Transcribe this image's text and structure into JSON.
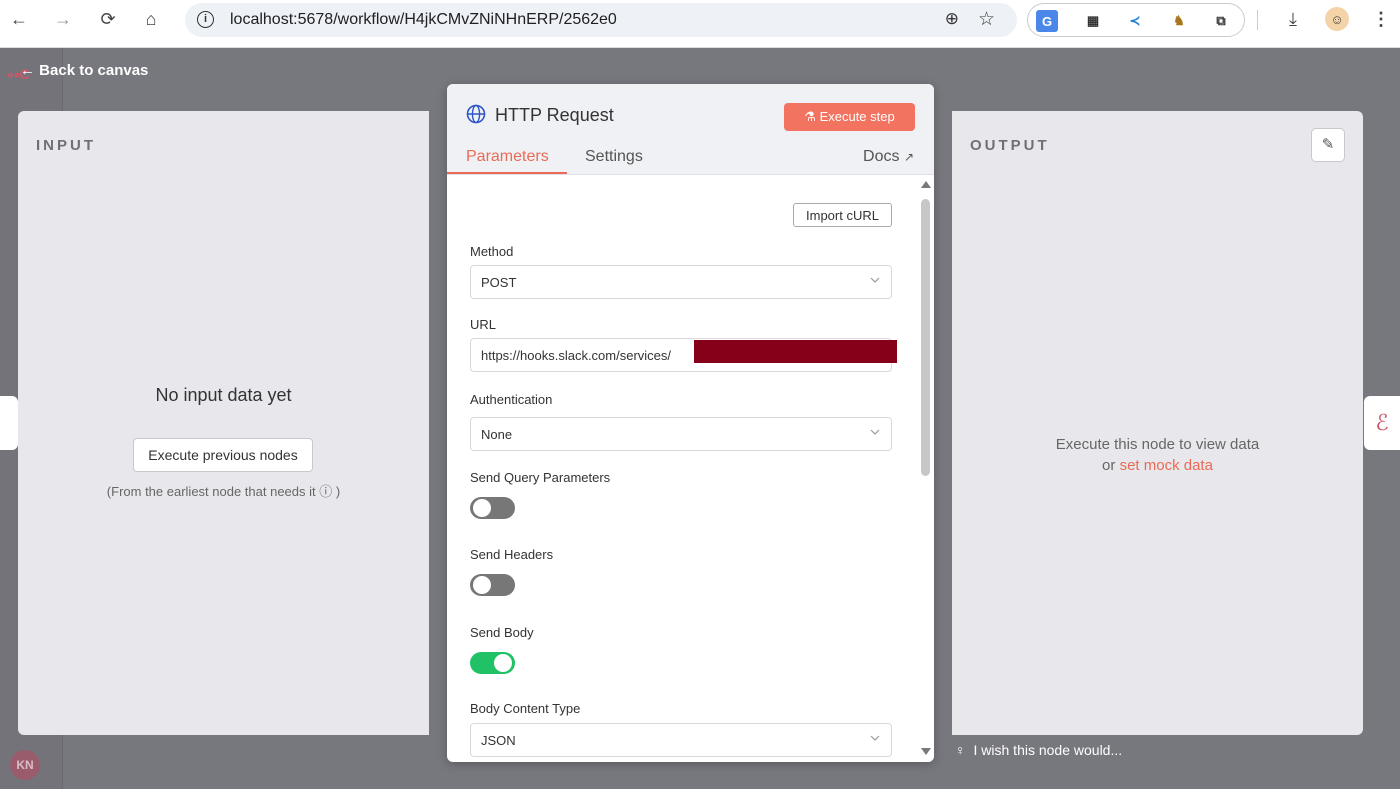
{
  "browser": {
    "url": "localhost:5678/workflow/H4jkCMvZNiNHnERP/2562e0"
  },
  "app": {
    "back_label": "Back to canvas",
    "avatar_initials": "KN"
  },
  "input_panel": {
    "title": "INPUT",
    "empty_message": "No input data yet",
    "execute_previous_label": "Execute previous nodes",
    "hint": "(From the earliest node that needs it ⓘ )"
  },
  "output_panel": {
    "title": "OUTPUT",
    "message_line1": "Execute this node to view data",
    "message_or": "or ",
    "mock_link": "set mock data",
    "wish_text": "I wish this node would..."
  },
  "node": {
    "title": "HTTP Request",
    "execute_label": "Execute step",
    "tabs": [
      "Parameters",
      "Settings"
    ],
    "docs_label": "Docs",
    "import_curl_label": "Import cURL",
    "fields": {
      "method_label": "Method",
      "method_value": "POST",
      "url_label": "URL",
      "url_value": "https://hooks.slack.com/services/",
      "auth_label": "Authentication",
      "auth_value": "None",
      "send_query_label": "Send Query Parameters",
      "send_query_on": false,
      "send_headers_label": "Send Headers",
      "send_headers_on": false,
      "send_body_label": "Send Body",
      "send_body_on": true,
      "body_type_label": "Body Content Type",
      "body_type_value": "JSON"
    }
  },
  "colors": {
    "accent": "#ea6b55",
    "execute_button": "#f2735f",
    "toggle_on": "#21c165",
    "redaction": "#86001a"
  }
}
